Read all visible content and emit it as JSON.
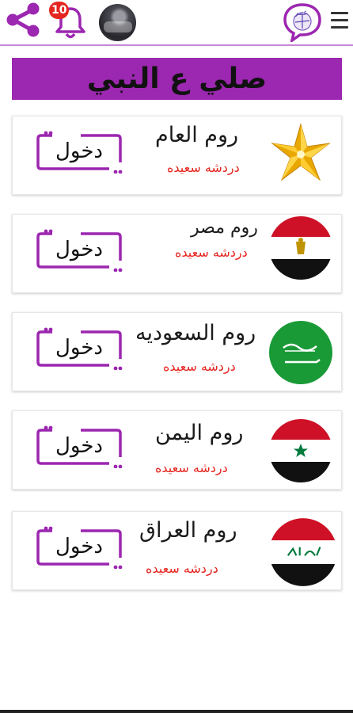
{
  "header": {
    "notification_count": "10",
    "logo_text": "عمر"
  },
  "banner": {
    "title": "صلي ع النبي"
  },
  "colors": {
    "accent": "#9c27b0",
    "subtitle_red": "#e5251f"
  },
  "rooms": [
    {
      "name": "روم العام",
      "subtitle": "دردشه سعيده",
      "button": "دخول",
      "flag_icon": "golden-star-icon"
    },
    {
      "name": "روم مصر",
      "subtitle": "دردشه سعيده",
      "button": "دخول",
      "flag_icon": "egypt-flag-icon"
    },
    {
      "name": "روم السعوديه",
      "subtitle": "دردشه سعيده",
      "button": "دخول",
      "flag_icon": "saudi-flag-icon"
    },
    {
      "name": "روم اليمن",
      "subtitle": "دردشه سعيده",
      "button": "دخول",
      "flag_icon": "syria-flag-icon"
    },
    {
      "name": "روم العراق",
      "subtitle": "دردشه سعيده",
      "button": "دخول",
      "flag_icon": "iraq-flag-icon"
    }
  ]
}
